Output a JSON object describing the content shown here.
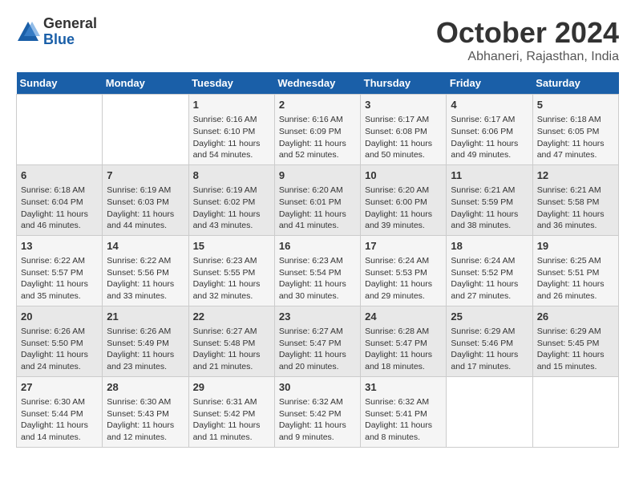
{
  "logo": {
    "general": "General",
    "blue": "Blue"
  },
  "header": {
    "title": "October 2024",
    "subtitle": "Abhaneri, Rajasthan, India"
  },
  "weekdays": [
    "Sunday",
    "Monday",
    "Tuesday",
    "Wednesday",
    "Thursday",
    "Friday",
    "Saturday"
  ],
  "weeks": [
    [
      {
        "day": "",
        "info": ""
      },
      {
        "day": "",
        "info": ""
      },
      {
        "day": "1",
        "info": "Sunrise: 6:16 AM\nSunset: 6:10 PM\nDaylight: 11 hours and 54 minutes."
      },
      {
        "day": "2",
        "info": "Sunrise: 6:16 AM\nSunset: 6:09 PM\nDaylight: 11 hours and 52 minutes."
      },
      {
        "day": "3",
        "info": "Sunrise: 6:17 AM\nSunset: 6:08 PM\nDaylight: 11 hours and 50 minutes."
      },
      {
        "day": "4",
        "info": "Sunrise: 6:17 AM\nSunset: 6:06 PM\nDaylight: 11 hours and 49 minutes."
      },
      {
        "day": "5",
        "info": "Sunrise: 6:18 AM\nSunset: 6:05 PM\nDaylight: 11 hours and 47 minutes."
      }
    ],
    [
      {
        "day": "6",
        "info": "Sunrise: 6:18 AM\nSunset: 6:04 PM\nDaylight: 11 hours and 46 minutes."
      },
      {
        "day": "7",
        "info": "Sunrise: 6:19 AM\nSunset: 6:03 PM\nDaylight: 11 hours and 44 minutes."
      },
      {
        "day": "8",
        "info": "Sunrise: 6:19 AM\nSunset: 6:02 PM\nDaylight: 11 hours and 43 minutes."
      },
      {
        "day": "9",
        "info": "Sunrise: 6:20 AM\nSunset: 6:01 PM\nDaylight: 11 hours and 41 minutes."
      },
      {
        "day": "10",
        "info": "Sunrise: 6:20 AM\nSunset: 6:00 PM\nDaylight: 11 hours and 39 minutes."
      },
      {
        "day": "11",
        "info": "Sunrise: 6:21 AM\nSunset: 5:59 PM\nDaylight: 11 hours and 38 minutes."
      },
      {
        "day": "12",
        "info": "Sunrise: 6:21 AM\nSunset: 5:58 PM\nDaylight: 11 hours and 36 minutes."
      }
    ],
    [
      {
        "day": "13",
        "info": "Sunrise: 6:22 AM\nSunset: 5:57 PM\nDaylight: 11 hours and 35 minutes."
      },
      {
        "day": "14",
        "info": "Sunrise: 6:22 AM\nSunset: 5:56 PM\nDaylight: 11 hours and 33 minutes."
      },
      {
        "day": "15",
        "info": "Sunrise: 6:23 AM\nSunset: 5:55 PM\nDaylight: 11 hours and 32 minutes."
      },
      {
        "day": "16",
        "info": "Sunrise: 6:23 AM\nSunset: 5:54 PM\nDaylight: 11 hours and 30 minutes."
      },
      {
        "day": "17",
        "info": "Sunrise: 6:24 AM\nSunset: 5:53 PM\nDaylight: 11 hours and 29 minutes."
      },
      {
        "day": "18",
        "info": "Sunrise: 6:24 AM\nSunset: 5:52 PM\nDaylight: 11 hours and 27 minutes."
      },
      {
        "day": "19",
        "info": "Sunrise: 6:25 AM\nSunset: 5:51 PM\nDaylight: 11 hours and 26 minutes."
      }
    ],
    [
      {
        "day": "20",
        "info": "Sunrise: 6:26 AM\nSunset: 5:50 PM\nDaylight: 11 hours and 24 minutes."
      },
      {
        "day": "21",
        "info": "Sunrise: 6:26 AM\nSunset: 5:49 PM\nDaylight: 11 hours and 23 minutes."
      },
      {
        "day": "22",
        "info": "Sunrise: 6:27 AM\nSunset: 5:48 PM\nDaylight: 11 hours and 21 minutes."
      },
      {
        "day": "23",
        "info": "Sunrise: 6:27 AM\nSunset: 5:47 PM\nDaylight: 11 hours and 20 minutes."
      },
      {
        "day": "24",
        "info": "Sunrise: 6:28 AM\nSunset: 5:47 PM\nDaylight: 11 hours and 18 minutes."
      },
      {
        "day": "25",
        "info": "Sunrise: 6:29 AM\nSunset: 5:46 PM\nDaylight: 11 hours and 17 minutes."
      },
      {
        "day": "26",
        "info": "Sunrise: 6:29 AM\nSunset: 5:45 PM\nDaylight: 11 hours and 15 minutes."
      }
    ],
    [
      {
        "day": "27",
        "info": "Sunrise: 6:30 AM\nSunset: 5:44 PM\nDaylight: 11 hours and 14 minutes."
      },
      {
        "day": "28",
        "info": "Sunrise: 6:30 AM\nSunset: 5:43 PM\nDaylight: 11 hours and 12 minutes."
      },
      {
        "day": "29",
        "info": "Sunrise: 6:31 AM\nSunset: 5:42 PM\nDaylight: 11 hours and 11 minutes."
      },
      {
        "day": "30",
        "info": "Sunrise: 6:32 AM\nSunset: 5:42 PM\nDaylight: 11 hours and 9 minutes."
      },
      {
        "day": "31",
        "info": "Sunrise: 6:32 AM\nSunset: 5:41 PM\nDaylight: 11 hours and 8 minutes."
      },
      {
        "day": "",
        "info": ""
      },
      {
        "day": "",
        "info": ""
      }
    ]
  ]
}
